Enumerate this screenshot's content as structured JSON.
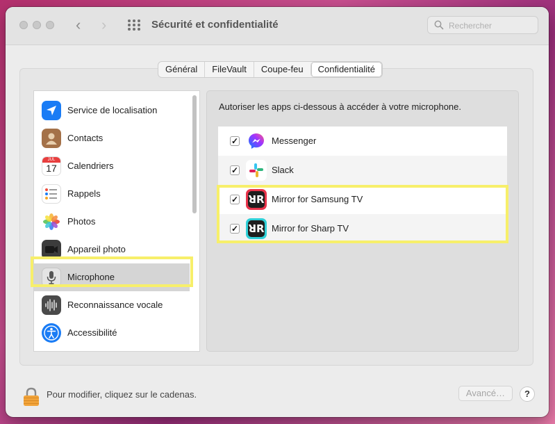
{
  "window": {
    "title": "Sécurité et confidentialité",
    "search_placeholder": "Rechercher"
  },
  "tabs": [
    {
      "label": "Général",
      "active": false
    },
    {
      "label": "FileVault",
      "active": false
    },
    {
      "label": "Coupe-feu",
      "active": false
    },
    {
      "label": "Confidentialité",
      "active": true
    }
  ],
  "sidebar": {
    "items": [
      {
        "label": "Service de localisation",
        "icon": "location-arrow-icon",
        "color": "#1a7cf5"
      },
      {
        "label": "Contacts",
        "icon": "contacts-icon",
        "color": "#a47148"
      },
      {
        "label": "Calendriers",
        "icon": "calendar-icon",
        "color": "#ffffff",
        "calendar_month": "JUL",
        "calendar_day": "17"
      },
      {
        "label": "Rappels",
        "icon": "reminders-icon",
        "color": "#ffffff"
      },
      {
        "label": "Photos",
        "icon": "photos-icon",
        "color": "#ffffff"
      },
      {
        "label": "Appareil photo",
        "icon": "camera-icon",
        "color": "#3c3c3c"
      },
      {
        "label": "Microphone",
        "icon": "microphone-icon",
        "color": "#d9d9d9",
        "selected": true
      },
      {
        "label": "Reconnaissance vocale",
        "icon": "waveform-icon",
        "color": "#4a4a4a"
      },
      {
        "label": "Accessibilité",
        "icon": "accessibility-icon",
        "color": "#1a7cf5"
      }
    ]
  },
  "main": {
    "description": "Autoriser les apps ci-dessous à accéder à votre microphone.",
    "apps": [
      {
        "name": "Messenger",
        "checked": true,
        "icon": "messenger-icon"
      },
      {
        "name": "Slack",
        "checked": true,
        "icon": "slack-icon"
      },
      {
        "name": "Mirror for Samsung TV",
        "checked": true,
        "icon": "mirror-samsung-icon",
        "color": "#e8334a"
      },
      {
        "name": "Mirror for Sharp TV",
        "checked": true,
        "icon": "mirror-sharp-icon",
        "color": "#2fd0d8"
      }
    ],
    "check_mark": "✓"
  },
  "footer": {
    "lock_text": "Pour modifier, cliquez sur le cadenas.",
    "advanced_label": "Avancé…",
    "help_label": "?"
  },
  "highlight_color": "#f7ef6a"
}
